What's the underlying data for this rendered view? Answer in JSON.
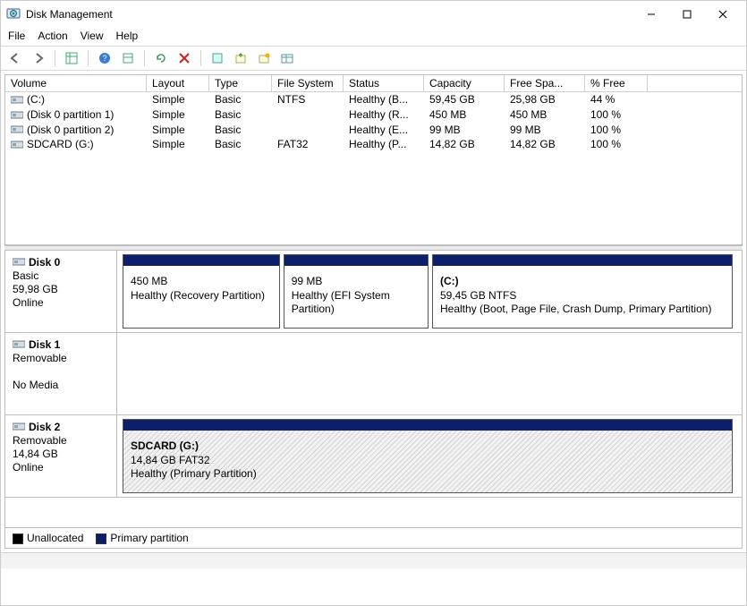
{
  "window": {
    "title": "Disk Management"
  },
  "menu": {
    "file": "File",
    "action": "Action",
    "view": "View",
    "help": "Help"
  },
  "volumeTable": {
    "headers": {
      "volume": "Volume",
      "layout": "Layout",
      "type": "Type",
      "fs": "File System",
      "status": "Status",
      "capacity": "Capacity",
      "free": "Free Spa...",
      "pct": "% Free"
    },
    "rows": [
      {
        "volume": "(C:)",
        "layout": "Simple",
        "type": "Basic",
        "fs": "NTFS",
        "status": "Healthy (B...",
        "capacity": "59,45 GB",
        "free": "25,98 GB",
        "pct": "44 %"
      },
      {
        "volume": "(Disk 0 partition 1)",
        "layout": "Simple",
        "type": "Basic",
        "fs": "",
        "status": "Healthy (R...",
        "capacity": "450 MB",
        "free": "450 MB",
        "pct": "100 %"
      },
      {
        "volume": "(Disk 0 partition 2)",
        "layout": "Simple",
        "type": "Basic",
        "fs": "",
        "status": "Healthy (E...",
        "capacity": "99 MB",
        "free": "99 MB",
        "pct": "100 %"
      },
      {
        "volume": "SDCARD (G:)",
        "layout": "Simple",
        "type": "Basic",
        "fs": "FAT32",
        "status": "Healthy (P...",
        "capacity": "14,82 GB",
        "free": "14,82 GB",
        "pct": "100 %"
      }
    ]
  },
  "disks": [
    {
      "name": "Disk 0",
      "kind": "Basic",
      "size": "59,98 GB",
      "state": "Online",
      "hasMedia": true,
      "partitions": [
        {
          "title": "",
          "line1": "450 MB",
          "line2": "Healthy (Recovery Partition)",
          "flex": 26,
          "hatched": false
        },
        {
          "title": "",
          "line1": "99 MB",
          "line2": "Healthy (EFI System Partition)",
          "flex": 24,
          "hatched": false
        },
        {
          "title": "(C:)",
          "line1": "59,45 GB NTFS",
          "line2": "Healthy (Boot, Page File, Crash Dump, Primary Partition)",
          "flex": 50,
          "hatched": false
        }
      ]
    },
    {
      "name": "Disk 1",
      "kind": "Removable",
      "size": "",
      "state": "No Media",
      "hasMedia": false,
      "partitions": []
    },
    {
      "name": "Disk 2",
      "kind": "Removable",
      "size": "14,84 GB",
      "state": "Online",
      "hasMedia": true,
      "partitions": [
        {
          "title": "SDCARD  (G:)",
          "line1": "14,84 GB FAT32",
          "line2": "Healthy (Primary Partition)",
          "flex": 100,
          "hatched": true
        }
      ]
    }
  ],
  "legend": {
    "unallocated": "Unallocated",
    "primary": "Primary partition"
  }
}
